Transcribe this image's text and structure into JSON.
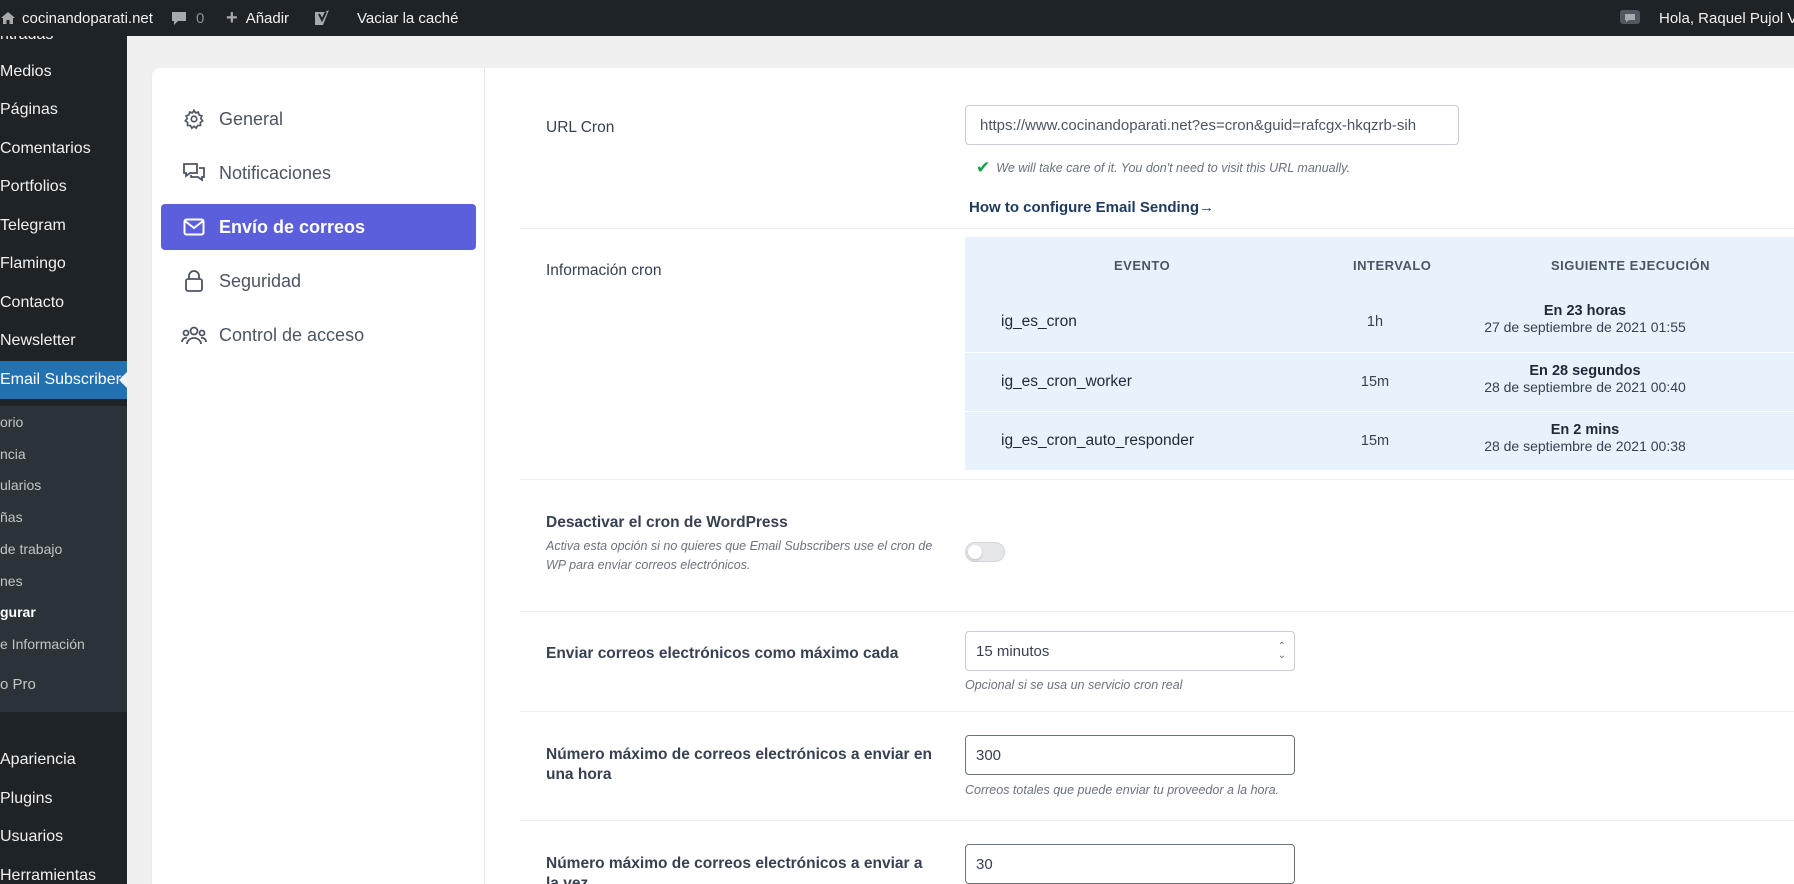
{
  "adminbar": {
    "site_name": "cocinandoparati.net",
    "comments_count": "0",
    "add_new": "Añadir",
    "clear_cache": "Vaciar la caché",
    "greeting": "Hola, Raquel Pujol Vi"
  },
  "menu": {
    "items": [
      "ntradas",
      "Medios",
      "Páginas",
      "Comentarios",
      "Portfolios",
      "Telegram",
      "Flamingo",
      "Contacto",
      "Newsletter",
      "Email Subscribers"
    ],
    "submenu": [
      "orio",
      "ncia",
      "ularios",
      "ñas",
      "de trabajo",
      "nes",
      "gurar",
      "e Información",
      "o Pro"
    ],
    "bottom_items": [
      "Apariencia",
      "Plugins",
      "Usuarios",
      "Herramientas"
    ]
  },
  "tabs": [
    {
      "label": "General",
      "icon": "gear-icon"
    },
    {
      "label": "Notificaciones",
      "icon": "chat-icon"
    },
    {
      "label": "Envío de correos",
      "icon": "mail-icon"
    },
    {
      "label": "Seguridad",
      "icon": "lock-icon"
    },
    {
      "label": "Control de acceso",
      "icon": "users-icon"
    }
  ],
  "settings": {
    "url_cron": {
      "label": "URL Cron",
      "value": "https://www.cocinandoparati.net?es=cron&guid=rafcgx-hkqzrb-sih",
      "note": "We will take care of it. You don't need to visit this URL manually.",
      "link": "How to configure Email Sending→"
    },
    "cron_info": {
      "label": "Información cron",
      "headers": [
        "EVENTO",
        "INTERVALO",
        "SIGUIENTE EJECUCIÓN"
      ],
      "rows": [
        {
          "event": "ig_es_cron",
          "interval": "1h",
          "next_rel": "En 23 horas",
          "next_date": "27 de septiembre de 2021 01:55"
        },
        {
          "event": "ig_es_cron_worker",
          "interval": "15m",
          "next_rel": "En 28 segundos",
          "next_date": "28 de septiembre de 2021 00:40"
        },
        {
          "event": "ig_es_cron_auto_responder",
          "interval": "15m",
          "next_rel": "En 2 mins",
          "next_date": "28 de septiembre de 2021 00:38"
        }
      ]
    },
    "disable_wp_cron": {
      "label": "Desactivar el cron de WordPress",
      "help": "Activa esta opción si no quieres que Email Subscribers use el cron de WP para enviar correos electrónicos.",
      "enabled": false
    },
    "send_every": {
      "label": "Enviar correos electrónicos como máximo cada",
      "value": "15 minutos",
      "help": "Opcional si se usa un servicio cron real"
    },
    "max_per_hour": {
      "label": "Número máximo de correos electrónicos a enviar en una hora",
      "value": "300",
      "help": "Correos totales que puede enviar tu proveedor a la hora."
    },
    "max_at_once": {
      "label": "Número máximo de correos electrónicos a enviar a la vez",
      "value": "30"
    }
  }
}
